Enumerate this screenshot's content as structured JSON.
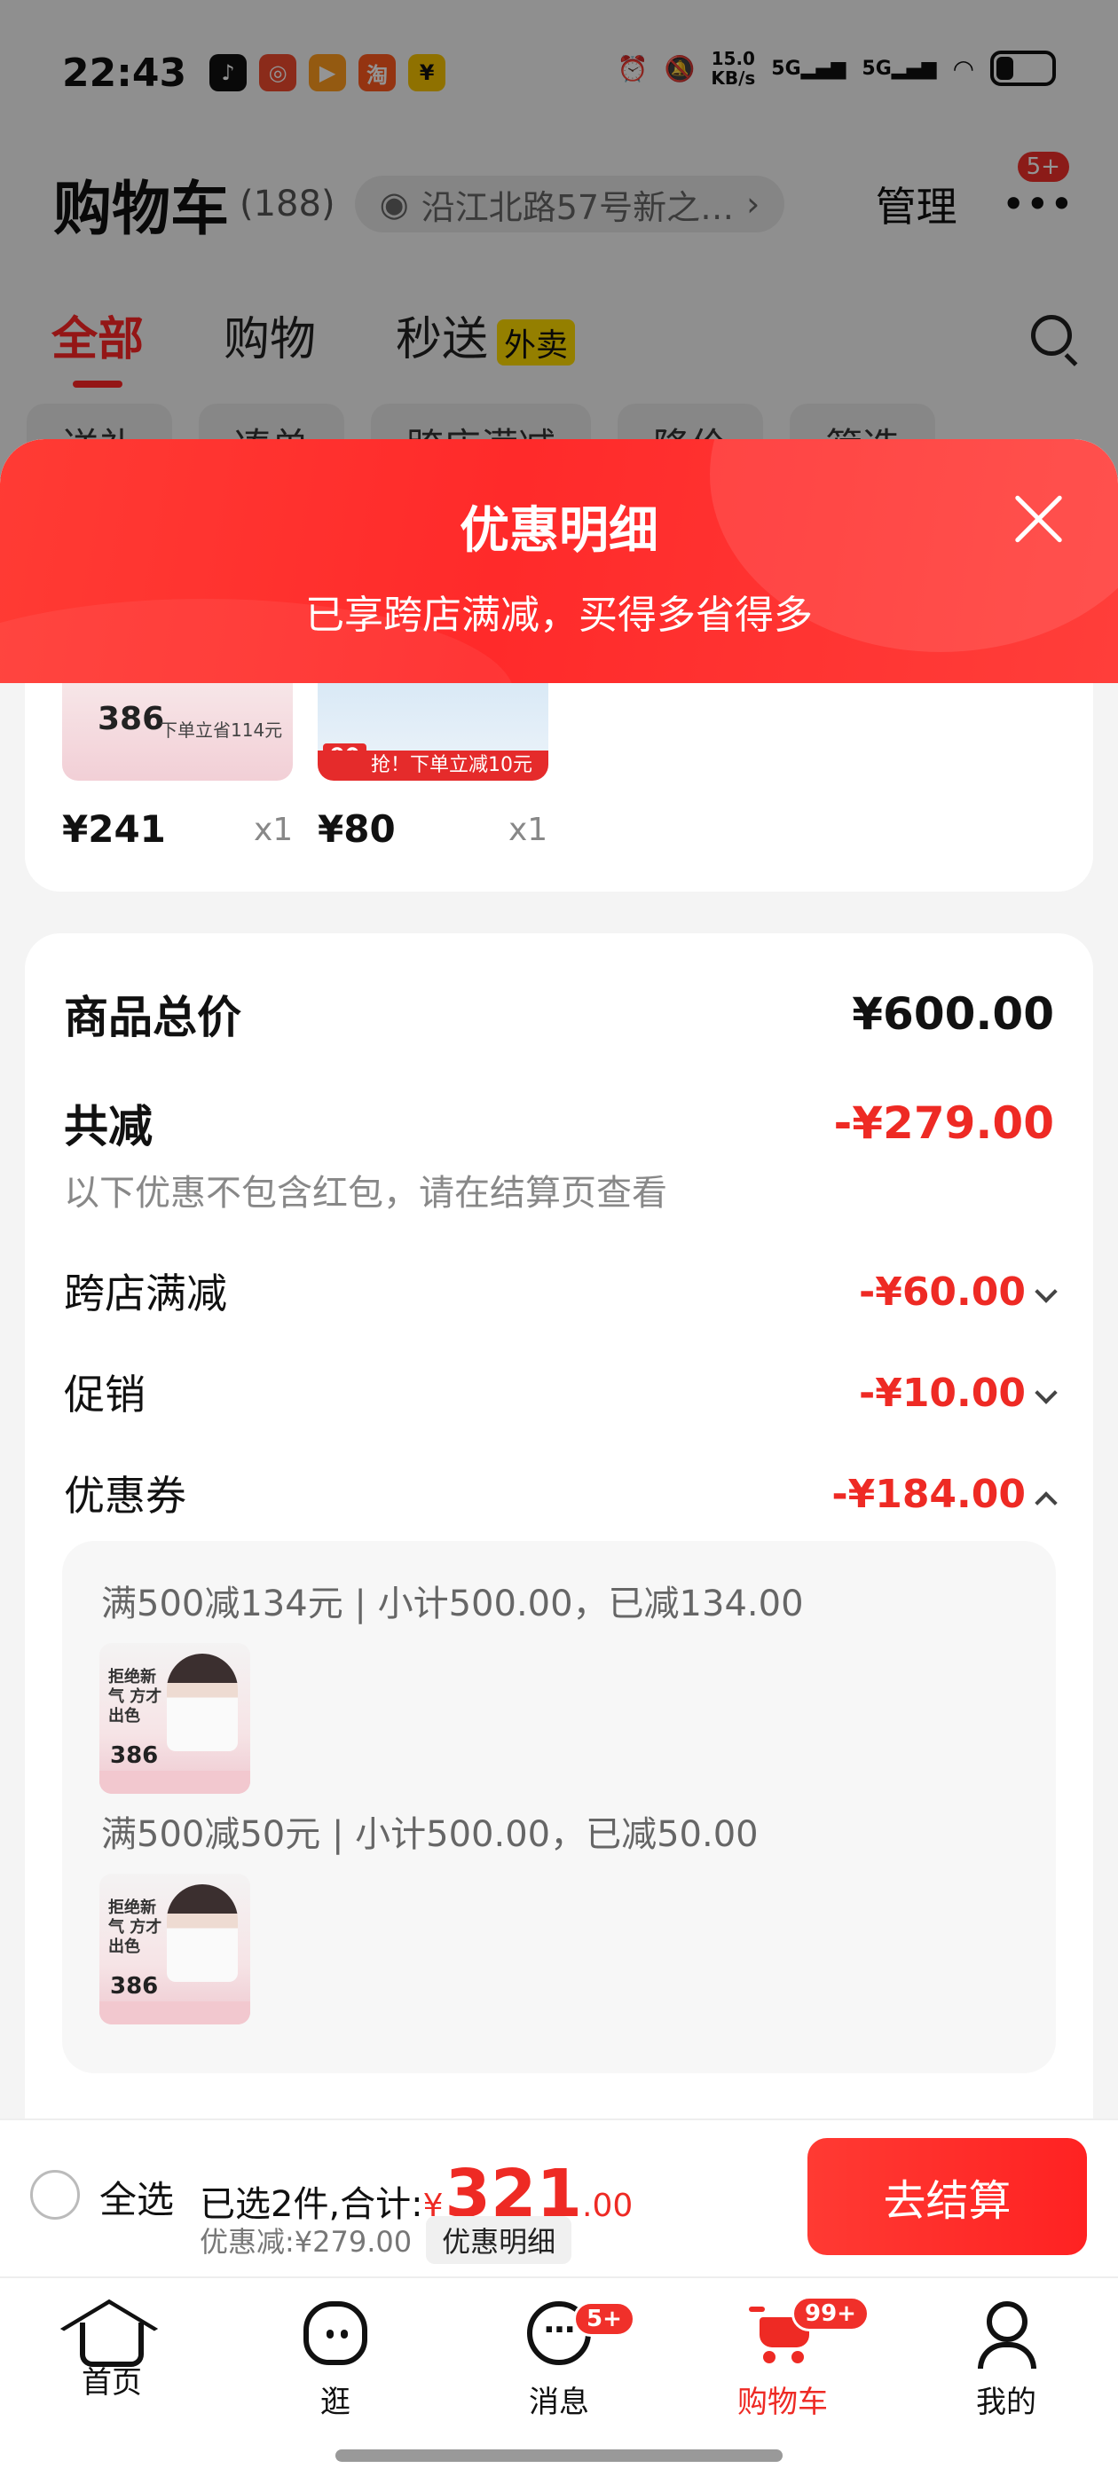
{
  "status_bar": {
    "time": "22:43",
    "net_speed_value": "15.0",
    "net_speed_unit": "KB/s",
    "signal1": "5G",
    "signal2": "5G",
    "battery_level": 0.3
  },
  "header": {
    "title": "购物车",
    "count": "(188)",
    "address": "沿江北路57号新之…",
    "manage": "管理",
    "more_badge": "5+"
  },
  "tabs": [
    {
      "label": "全部",
      "active": true
    },
    {
      "label": "购物",
      "active": false
    },
    {
      "label": "秒送",
      "tag": "外卖",
      "active": false
    }
  ],
  "filters": [
    "送礼",
    "凑单",
    "跨店满减",
    "降价",
    "筛选"
  ],
  "sheet": {
    "title": "优惠明细",
    "subtitle": "已享跨店满减，买得多省得多"
  },
  "goods": [
    {
      "thumb_num": "386",
      "price": "¥241",
      "qty": "x1"
    },
    {
      "thumb_num": "90",
      "price": "¥80",
      "qty": "x1",
      "banner": "抢！下单立减10元"
    }
  ],
  "detail": {
    "total_label": "商品总价",
    "total_value": "¥600.00",
    "reduce_label": "共减",
    "reduce_value": "-¥279.00",
    "note": "以下优惠不包含红包，请在结算页查看",
    "items": [
      {
        "label": "跨店满减",
        "value": "-¥60.00",
        "expanded": false
      },
      {
        "label": "促销",
        "value": "-¥10.00",
        "expanded": false
      },
      {
        "label": "优惠券",
        "value": "-¥184.00",
        "expanded": true
      }
    ],
    "coupons": [
      {
        "text": "满500减134元 | 小计500.00，已减134.00",
        "thumb_num": "386",
        "thumb_text": "拒绝新气 方才出色"
      },
      {
        "text": "满500减50元 | 小计500.00，已减50.00",
        "thumb_num": "386",
        "thumb_text": "拒绝新气 方才出色"
      }
    ]
  },
  "checkout": {
    "select_all": "全选",
    "selected_text": "已选2件,合计:",
    "currency": "¥",
    "amount_int": "321",
    "amount_dec": ".00",
    "discount_text": "优惠减:¥279.00",
    "discount_button": "优惠明细",
    "pay_button": "去结算"
  },
  "bottom_nav": [
    {
      "label": "首页",
      "icon": "home-icon"
    },
    {
      "label": "逛",
      "icon": "browse-icon"
    },
    {
      "label": "消息",
      "icon": "message-icon",
      "badge": "5+"
    },
    {
      "label": "购物车",
      "icon": "cart-icon",
      "badge": "99+",
      "active": true
    },
    {
      "label": "我的",
      "icon": "profile-icon"
    }
  ],
  "colors": {
    "accent": "#ee2a24",
    "header_red": "#ff2a2a",
    "tag_yellow": "#ffdb00"
  }
}
